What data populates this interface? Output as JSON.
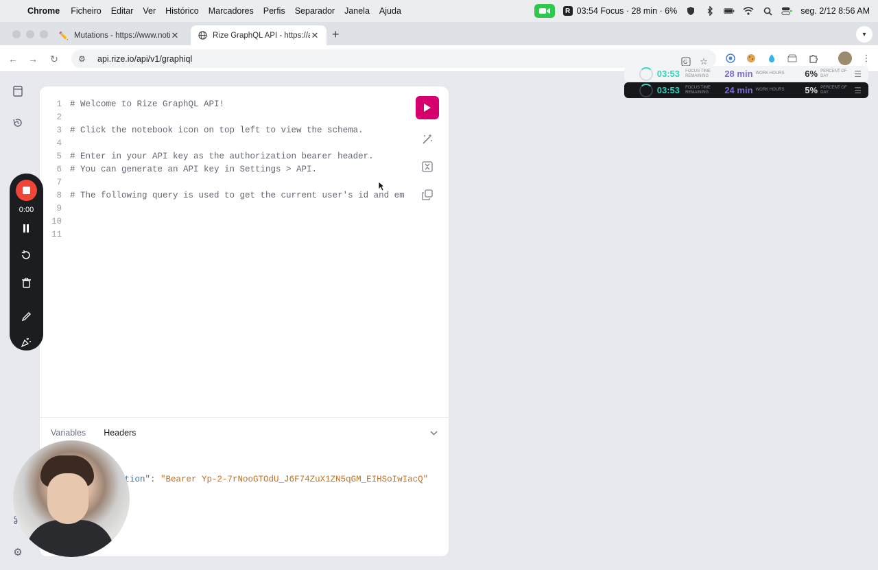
{
  "menubar": {
    "items": [
      "Chrome",
      "Ficheiro",
      "Editar",
      "Ver",
      "Histórico",
      "Marcadores",
      "Perfis",
      "Separador",
      "Janela",
      "Ajuda"
    ],
    "rize_status": "03:54 Focus · 28 min · 6%",
    "datetime": "seg. 2/12  8:56 AM"
  },
  "tabs": [
    {
      "label": "Mutations - https://www.notio",
      "icon": "pencil-icon",
      "active": false
    },
    {
      "label": "Rize GraphQL API - https://ap",
      "icon": "globe-icon",
      "active": true
    }
  ],
  "toolbar": {
    "url": "api.rize.io/api/v1/graphiql"
  },
  "rize_overlays": [
    {
      "time": "03:53",
      "time_caption": "FOCUS TIME REMAINING",
      "mins": "28 min",
      "mins_caption": "WORK HOURS",
      "pct": "6%",
      "pct_caption": "PERCENT OF DAY"
    },
    {
      "time": "03:53",
      "time_caption": "FOCUS TIME REMAINING",
      "mins": "24 min",
      "mins_caption": "WORK HOURS",
      "pct": "5%",
      "pct_caption": "PERCENT OF DAY"
    }
  ],
  "editor": {
    "lines": [
      {
        "n": "1",
        "text": "# Welcome to Rize GraphQL API!"
      },
      {
        "n": "2",
        "text": ""
      },
      {
        "n": "3",
        "text": "# Click the notebook icon on top left to view the schema."
      },
      {
        "n": "4",
        "text": ""
      },
      {
        "n": "5",
        "text": "# Enter in your API key as the authorization bearer header."
      },
      {
        "n": "6",
        "text": "# You can generate an API key in Settings > API."
      },
      {
        "n": "7",
        "text": ""
      },
      {
        "n": "8",
        "text": "# The following query is used to get the current user's id and em"
      },
      {
        "n": "9",
        "text": ""
      },
      {
        "n": "10",
        "text": ""
      },
      {
        "n": "11",
        "text": ""
      }
    ],
    "bottom_tabs": [
      "Variables",
      "Headers"
    ],
    "active_bottom_tab": "Headers",
    "header_key_fragment": "ation",
    "header_punct": "\": ",
    "header_value": "\"Bearer Yp-2-7rNooGTOdU_J6F74ZuX1ZN5qGM_EIHSoIwIacQ\""
  },
  "recorder": {
    "time": "0:00"
  },
  "colors": {
    "run_button": "#d5006d",
    "rize_teal": "#2fd3bd",
    "rize_purple": "#7b6bd8",
    "record_red": "#f0463a"
  }
}
